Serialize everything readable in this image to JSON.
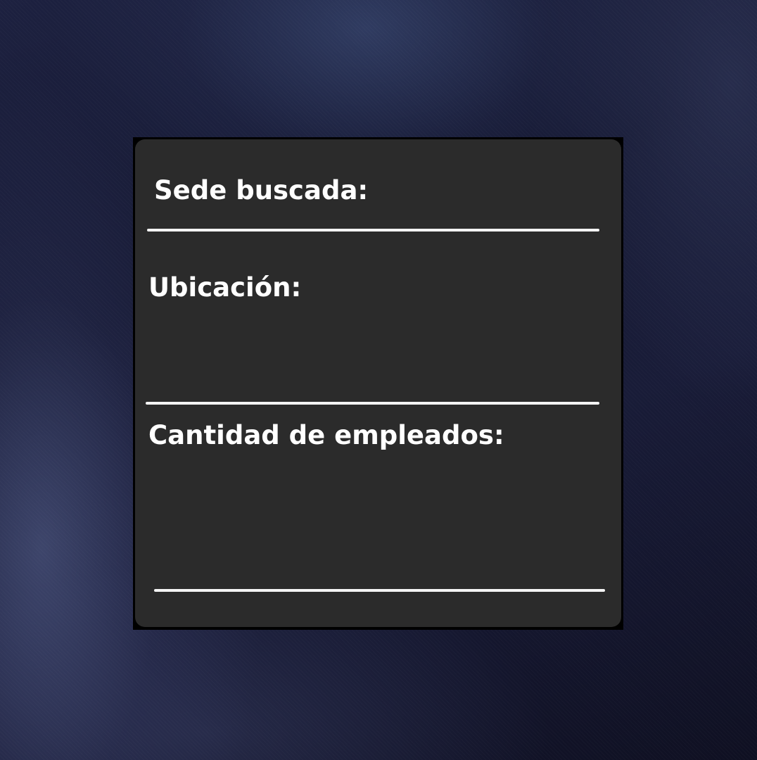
{
  "form": {
    "sede": {
      "label": "Sede buscada:",
      "value": ""
    },
    "ubicacion": {
      "label": "Ubicación:",
      "value": ""
    },
    "empleados": {
      "label": "Cantidad de empleados:",
      "value": ""
    }
  },
  "colors": {
    "panel_background": "#2b2b2b",
    "panel_border": "#000000",
    "text": "#ffffff",
    "underline": "#f4f4f4",
    "wallpaper_base": "#141730"
  }
}
